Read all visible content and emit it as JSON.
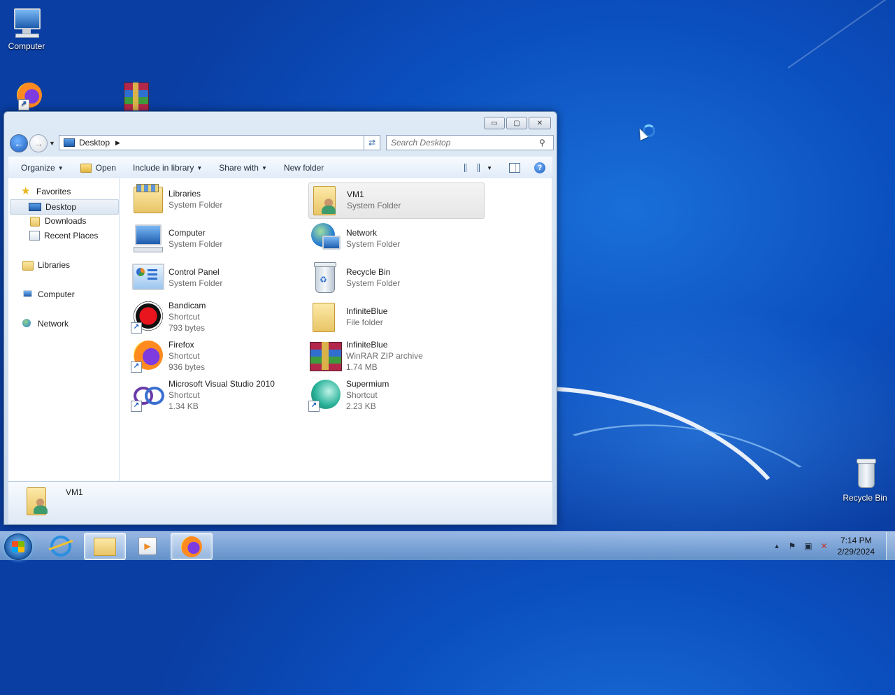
{
  "desktop": {
    "icons": [
      {
        "label": "Computer"
      },
      {
        "label": "Recycle Bin"
      }
    ]
  },
  "window": {
    "controls": {
      "minimize": "▭",
      "maximize": "▢",
      "close": "✕"
    },
    "address": {
      "location": "Desktop"
    },
    "search": {
      "placeholder": "Search Desktop"
    },
    "toolbar": {
      "organize": "Organize",
      "open": "Open",
      "include_in_library": "Include in library",
      "share_with": "Share with",
      "new_folder": "New folder",
      "help": "?"
    },
    "nav": {
      "favorites": "Favorites",
      "desktop": "Desktop",
      "downloads": "Downloads",
      "recent_places": "Recent Places",
      "libraries": "Libraries",
      "computer": "Computer",
      "network": "Network"
    },
    "items": [
      {
        "name": "Libraries",
        "type": "System Folder",
        "size": ""
      },
      {
        "name": "VM1",
        "type": "System Folder",
        "size": ""
      },
      {
        "name": "Computer",
        "type": "System Folder",
        "size": ""
      },
      {
        "name": "Network",
        "type": "System Folder",
        "size": ""
      },
      {
        "name": "Control Panel",
        "type": "System Folder",
        "size": ""
      },
      {
        "name": "Recycle Bin",
        "type": "System Folder",
        "size": ""
      },
      {
        "name": "Bandicam",
        "type": "Shortcut",
        "size": "793 bytes"
      },
      {
        "name": "InfiniteBlue",
        "type": "File folder",
        "size": ""
      },
      {
        "name": "Firefox",
        "type": "Shortcut",
        "size": "936 bytes"
      },
      {
        "name": "InfiniteBlue",
        "type": "WinRAR ZIP archive",
        "size": "1.74 MB"
      },
      {
        "name": "Microsoft Visual Studio 2010",
        "type": "Shortcut",
        "size": "1.34 KB"
      },
      {
        "name": "Supermium",
        "type": "Shortcut",
        "size": "2.23 KB"
      }
    ],
    "details": {
      "name": "VM1"
    }
  },
  "taskbar": {
    "clock": {
      "time": "7:14 PM",
      "date": "2/29/2024"
    }
  }
}
